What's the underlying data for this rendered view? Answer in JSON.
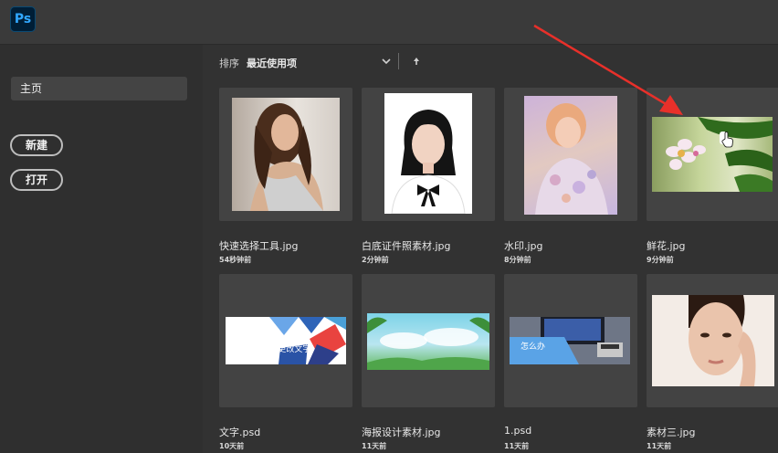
{
  "app": {
    "logo_text": "Ps",
    "accent": "#31a8ff"
  },
  "sidebar": {
    "home_label": "主页",
    "new_button": "新建",
    "open_button": "打开"
  },
  "sort": {
    "label": "排序",
    "value": "最近使用项"
  },
  "files": [
    {
      "name": "快速选择工具.jpg",
      "time": "54秒钟前"
    },
    {
      "name": "白底证件照素材.jpg",
      "time": "2分钟前"
    },
    {
      "name": "水印.jpg",
      "time": "8分钟前"
    },
    {
      "name": "鲜花.jpg",
      "time": "9分钟前"
    },
    {
      "name": "文字.psd",
      "time": "10天前",
      "thumb_text": "ps图片中怎么更改文字"
    },
    {
      "name": "海报设计素材.jpg",
      "time": "11天前"
    },
    {
      "name": "1.psd",
      "time": "11天前",
      "thumb_text": "怎么办"
    },
    {
      "name": "素材三.jpg",
      "time": "11天前"
    }
  ],
  "annotation_color": "#e8302a"
}
